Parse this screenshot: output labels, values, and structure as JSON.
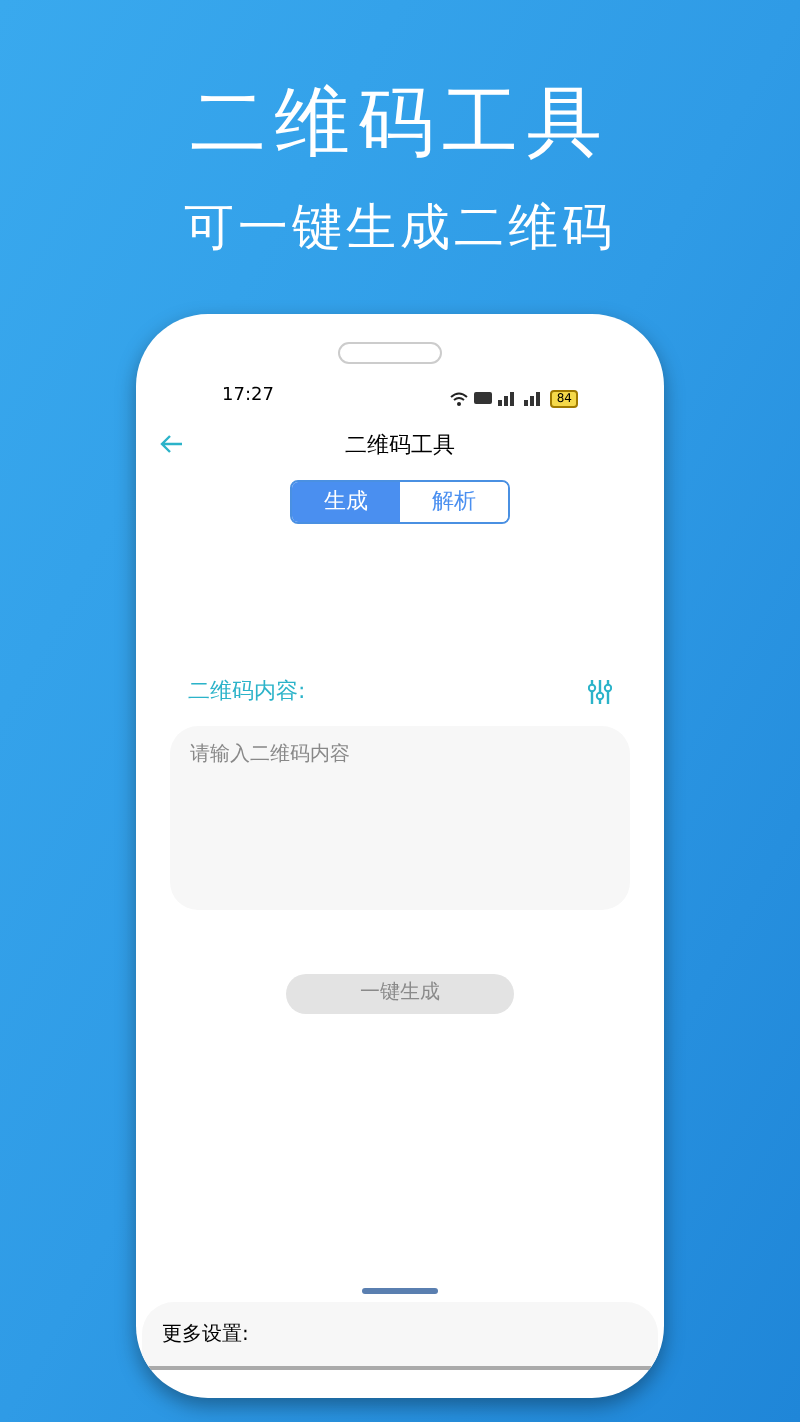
{
  "headline": "二维码工具",
  "subtitle": "可一键生成二维码",
  "status_bar": {
    "time": "17:27",
    "battery": "84"
  },
  "app_bar": {
    "title": "二维码工具"
  },
  "tabs": [
    {
      "label": "生成",
      "selected": true
    },
    {
      "label": "解析",
      "selected": false
    }
  ],
  "content_label": "二维码内容:",
  "input": {
    "placeholder": "请输入二维码内容"
  },
  "generate_button": {
    "label": "一键生成",
    "disabled": true
  },
  "more_settings": {
    "label": "更多设置:"
  }
}
